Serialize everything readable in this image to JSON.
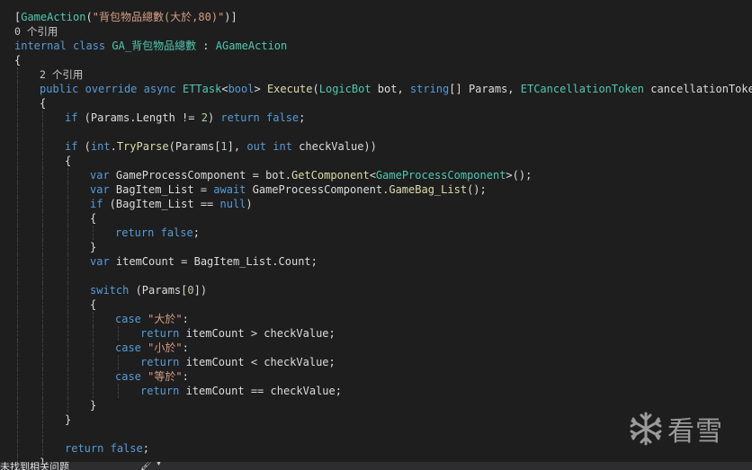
{
  "editor": {
    "language": "C#",
    "lines": [
      {
        "indent": 0,
        "tokens": [
          [
            "plain",
            "["
          ],
          [
            "ty",
            "GameAction"
          ],
          [
            "plain",
            "("
          ],
          [
            "str",
            "\"背包物品總數(大於,80)\""
          ],
          [
            "plain",
            ")]"
          ]
        ]
      },
      {
        "indent": 0,
        "tokens": [
          [
            "ref",
            "0 个引用"
          ]
        ]
      },
      {
        "indent": 0,
        "tokens": [
          [
            "kw",
            "internal"
          ],
          [
            "plain",
            " "
          ],
          [
            "kw",
            "class"
          ],
          [
            "plain",
            " "
          ],
          [
            "ty",
            "GA_背包物品總數"
          ],
          [
            "plain",
            " : "
          ],
          [
            "ty",
            "AGameAction"
          ]
        ]
      },
      {
        "indent": 0,
        "tokens": [
          [
            "plain",
            "{"
          ]
        ]
      },
      {
        "indent": 1,
        "tokens": [
          [
            "ref",
            "2 个引用"
          ]
        ]
      },
      {
        "indent": 1,
        "tokens": [
          [
            "kw",
            "public"
          ],
          [
            "plain",
            " "
          ],
          [
            "kw",
            "override"
          ],
          [
            "plain",
            " "
          ],
          [
            "kw",
            "async"
          ],
          [
            "plain",
            " "
          ],
          [
            "ty",
            "ETTask"
          ],
          [
            "plain",
            "<"
          ],
          [
            "kw",
            "bool"
          ],
          [
            "plain",
            "> "
          ],
          [
            "fn",
            "Execute"
          ],
          [
            "plain",
            "("
          ],
          [
            "ty",
            "LogicBot"
          ],
          [
            "plain",
            " bot, "
          ],
          [
            "kw",
            "string"
          ],
          [
            "plain",
            "[] Params, "
          ],
          [
            "ty",
            "ETCancellationToken"
          ],
          [
            "plain",
            " cancellationToken)"
          ]
        ]
      },
      {
        "indent": 1,
        "tokens": [
          [
            "plain",
            "{"
          ]
        ]
      },
      {
        "indent": 2,
        "tokens": [
          [
            "kw",
            "if"
          ],
          [
            "plain",
            " (Params.Length != "
          ],
          [
            "num",
            "2"
          ],
          [
            "plain",
            ") "
          ],
          [
            "kw",
            "return"
          ],
          [
            "plain",
            " "
          ],
          [
            "kw",
            "false"
          ],
          [
            "plain",
            ";"
          ]
        ]
      },
      {
        "indent": 2,
        "tokens": []
      },
      {
        "indent": 2,
        "tokens": [
          [
            "kw",
            "if"
          ],
          [
            "plain",
            " ("
          ],
          [
            "kw",
            "int"
          ],
          [
            "plain",
            "."
          ],
          [
            "fn",
            "TryParse"
          ],
          [
            "plain",
            "(Params["
          ],
          [
            "num",
            "1"
          ],
          [
            "plain",
            "], "
          ],
          [
            "kw",
            "out"
          ],
          [
            "plain",
            " "
          ],
          [
            "kw",
            "int"
          ],
          [
            "plain",
            " checkValue))"
          ]
        ]
      },
      {
        "indent": 2,
        "tokens": [
          [
            "plain",
            "{"
          ]
        ]
      },
      {
        "indent": 3,
        "tokens": [
          [
            "kw",
            "var"
          ],
          [
            "plain",
            " GameProcessComponent = bot."
          ],
          [
            "fn",
            "GetComponent"
          ],
          [
            "plain",
            "<"
          ],
          [
            "ty",
            "GameProcessComponent"
          ],
          [
            "plain",
            ">();"
          ]
        ]
      },
      {
        "indent": 3,
        "tokens": [
          [
            "kw",
            "var"
          ],
          [
            "plain",
            " BagItem_List = "
          ],
          [
            "kw",
            "await"
          ],
          [
            "plain",
            " GameProcessComponent."
          ],
          [
            "fn",
            "GameBag_List"
          ],
          [
            "plain",
            "();"
          ]
        ]
      },
      {
        "indent": 3,
        "tokens": [
          [
            "kw",
            "if"
          ],
          [
            "plain",
            " (BagItem_List == "
          ],
          [
            "kw",
            "null"
          ],
          [
            "plain",
            ")"
          ]
        ]
      },
      {
        "indent": 3,
        "tokens": [
          [
            "plain",
            "{"
          ]
        ]
      },
      {
        "indent": 4,
        "tokens": [
          [
            "kw",
            "return"
          ],
          [
            "plain",
            " "
          ],
          [
            "kw",
            "false"
          ],
          [
            "plain",
            ";"
          ]
        ]
      },
      {
        "indent": 3,
        "tokens": [
          [
            "plain",
            "}"
          ]
        ]
      },
      {
        "indent": 3,
        "tokens": [
          [
            "kw",
            "var"
          ],
          [
            "plain",
            " itemCount = BagItem_List.Count;"
          ]
        ]
      },
      {
        "indent": 3,
        "tokens": []
      },
      {
        "indent": 3,
        "tokens": [
          [
            "kw",
            "switch"
          ],
          [
            "plain",
            " (Params["
          ],
          [
            "num",
            "0"
          ],
          [
            "plain",
            "])"
          ]
        ]
      },
      {
        "indent": 3,
        "tokens": [
          [
            "plain",
            "{"
          ]
        ]
      },
      {
        "indent": 4,
        "tokens": [
          [
            "kw",
            "case"
          ],
          [
            "plain",
            " "
          ],
          [
            "str",
            "\"大於\""
          ],
          [
            "plain",
            ":"
          ]
        ]
      },
      {
        "indent": 5,
        "tokens": [
          [
            "kw",
            "return"
          ],
          [
            "plain",
            " itemCount > checkValue;"
          ]
        ]
      },
      {
        "indent": 4,
        "tokens": [
          [
            "kw",
            "case"
          ],
          [
            "plain",
            " "
          ],
          [
            "str",
            "\"小於\""
          ],
          [
            "plain",
            ":"
          ]
        ]
      },
      {
        "indent": 5,
        "tokens": [
          [
            "kw",
            "return"
          ],
          [
            "plain",
            " itemCount < checkValue;"
          ]
        ]
      },
      {
        "indent": 4,
        "tokens": [
          [
            "kw",
            "case"
          ],
          [
            "plain",
            " "
          ],
          [
            "str",
            "\"等於\""
          ],
          [
            "plain",
            ":"
          ]
        ]
      },
      {
        "indent": 5,
        "tokens": [
          [
            "kw",
            "return"
          ],
          [
            "plain",
            " itemCount == checkValue;"
          ]
        ]
      },
      {
        "indent": 3,
        "tokens": [
          [
            "plain",
            "}"
          ]
        ]
      },
      {
        "indent": 2,
        "tokens": [
          [
            "plain",
            "}"
          ]
        ]
      },
      {
        "indent": 2,
        "tokens": []
      },
      {
        "indent": 2,
        "tokens": [
          [
            "kw",
            "return"
          ],
          [
            "plain",
            " "
          ],
          [
            "kw",
            "false"
          ],
          [
            "plain",
            ";"
          ]
        ]
      },
      {
        "indent": 1,
        "tokens": [
          [
            "plain",
            "}"
          ]
        ]
      }
    ]
  },
  "watermark": {
    "text": "看雪",
    "icon": "snowflake-icon"
  },
  "statusbar": {
    "message": "未找到相关问题",
    "icon": "brush-icon"
  },
  "colors": {
    "background": "#1e1e1e",
    "keyword": "#569cd6",
    "type": "#4ec9b0",
    "method": "#dcdcaa",
    "string": "#d69d85",
    "number": "#b5cea8",
    "text": "#dcdcdc"
  }
}
